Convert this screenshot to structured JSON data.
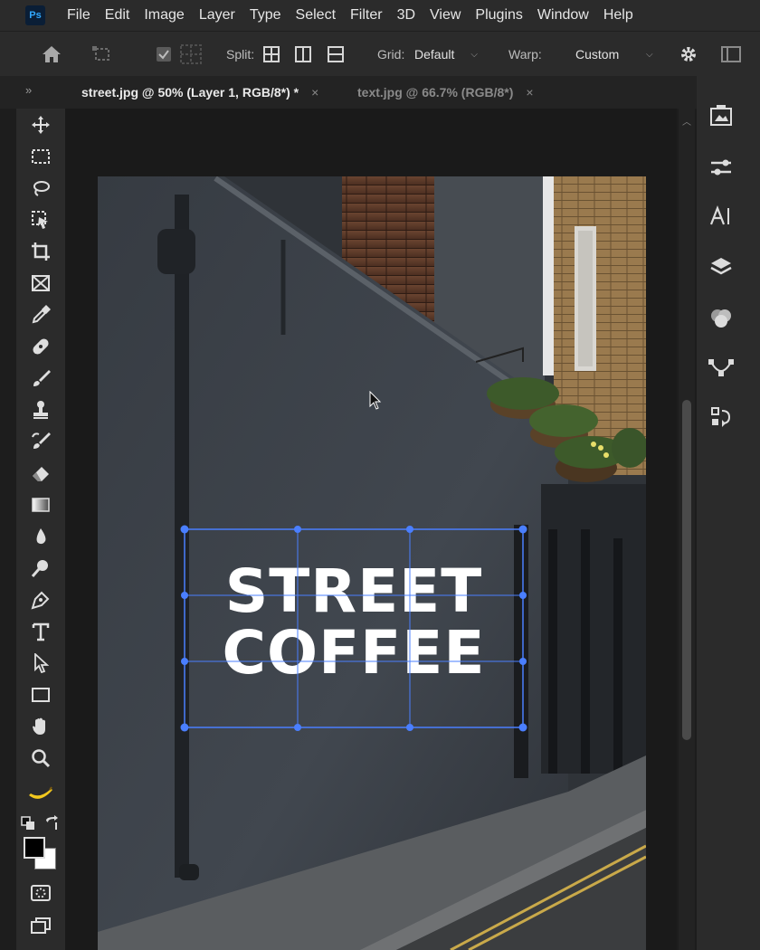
{
  "app": {
    "logo": "Ps"
  },
  "menu": [
    "File",
    "Edit",
    "Image",
    "Layer",
    "Type",
    "Select",
    "Filter",
    "3D",
    "View",
    "Plugins",
    "Window",
    "Help"
  ],
  "options": {
    "split_label": "Split:",
    "grid_label": "Grid:",
    "grid_value": "Default",
    "warp_label": "Warp:",
    "warp_value": "Custom"
  },
  "tabs": [
    {
      "title": "street.jpg @ 50% (Layer 1, RGB/8*) *",
      "active": true
    },
    {
      "title": "text.jpg @ 66.7% (RGB/8*)",
      "active": false
    }
  ],
  "tab_close": "×",
  "collapse_left": "»",
  "collapse_right": "«",
  "tools": [
    "move-icon",
    "marquee-icon",
    "lasso-icon",
    "object-select-icon",
    "crop-icon",
    "frame-icon",
    "eyedropper-icon",
    "healing-icon",
    "brush-icon",
    "stamp-icon",
    "history-brush-icon",
    "eraser-icon",
    "gradient-icon",
    "blur-icon",
    "dodge-icon",
    "pen-icon",
    "type-icon",
    "path-select-icon",
    "rectangle-icon",
    "hand-icon",
    "zoom-icon",
    "banana-icon"
  ],
  "right_panel_icons": [
    "libraries-icon",
    "adjustments-icon",
    "character-icon",
    "layers-icon",
    "channels-icon",
    "paths-icon",
    "history-icon"
  ],
  "canvas": {
    "headline_line1": "STREET",
    "headline_line2": "COFFEE"
  },
  "colors": {
    "accent_selection": "#4a7fff",
    "foreground": "#000000",
    "background": "#ffffff"
  }
}
